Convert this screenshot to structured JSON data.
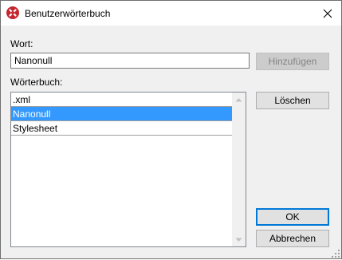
{
  "window": {
    "title": "Benutzerwörterbuch"
  },
  "word": {
    "label": "Wort:",
    "value": "Nanonull",
    "add_label": "Hinzufügen"
  },
  "dictionary": {
    "label": "Wörterbuch:",
    "items": [
      {
        "text": ".xml",
        "selected": false
      },
      {
        "text": "Nanonull",
        "selected": true
      },
      {
        "text": "Stylesheet",
        "selected": false
      }
    ]
  },
  "buttons": {
    "delete": "Löschen",
    "ok": "OK",
    "cancel": "Abbrechen"
  },
  "colors": {
    "selection": "#3399ff",
    "default_border": "#0078d7",
    "app_icon": "#c4262e"
  }
}
